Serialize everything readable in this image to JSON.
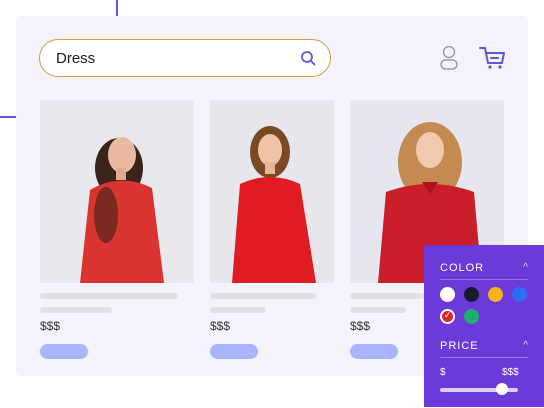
{
  "search": {
    "value": "Dress"
  },
  "header_icons": {
    "user": "user-icon",
    "cart": "cart-icon"
  },
  "products": [
    {
      "price": "$$$",
      "dress_color": "#d9342f"
    },
    {
      "price": "$$$",
      "dress_color": "#e01b22"
    },
    {
      "price": "$$$",
      "dress_color": "#ca1f2b"
    }
  ],
  "filter": {
    "color_title": "COLOR",
    "price_title": "PRICE",
    "swatches": [
      {
        "name": "white",
        "color": "#ffffff",
        "selected": false
      },
      {
        "name": "black",
        "color": "#1a1a2e",
        "selected": false
      },
      {
        "name": "yellow",
        "color": "#f5b21a",
        "selected": false
      },
      {
        "name": "blue",
        "color": "#2b6ff0",
        "selected": false
      },
      {
        "name": "red",
        "color": "#e0242a",
        "selected": true
      },
      {
        "name": "green",
        "color": "#1fae6e",
        "selected": false
      }
    ],
    "price_min_label": "$",
    "price_max_label": "$$$",
    "price_slider_value": 0.8
  },
  "colors": {
    "accent": "#6b3ad8",
    "button": "#aab5ff",
    "search_border": "#c9a33b"
  }
}
